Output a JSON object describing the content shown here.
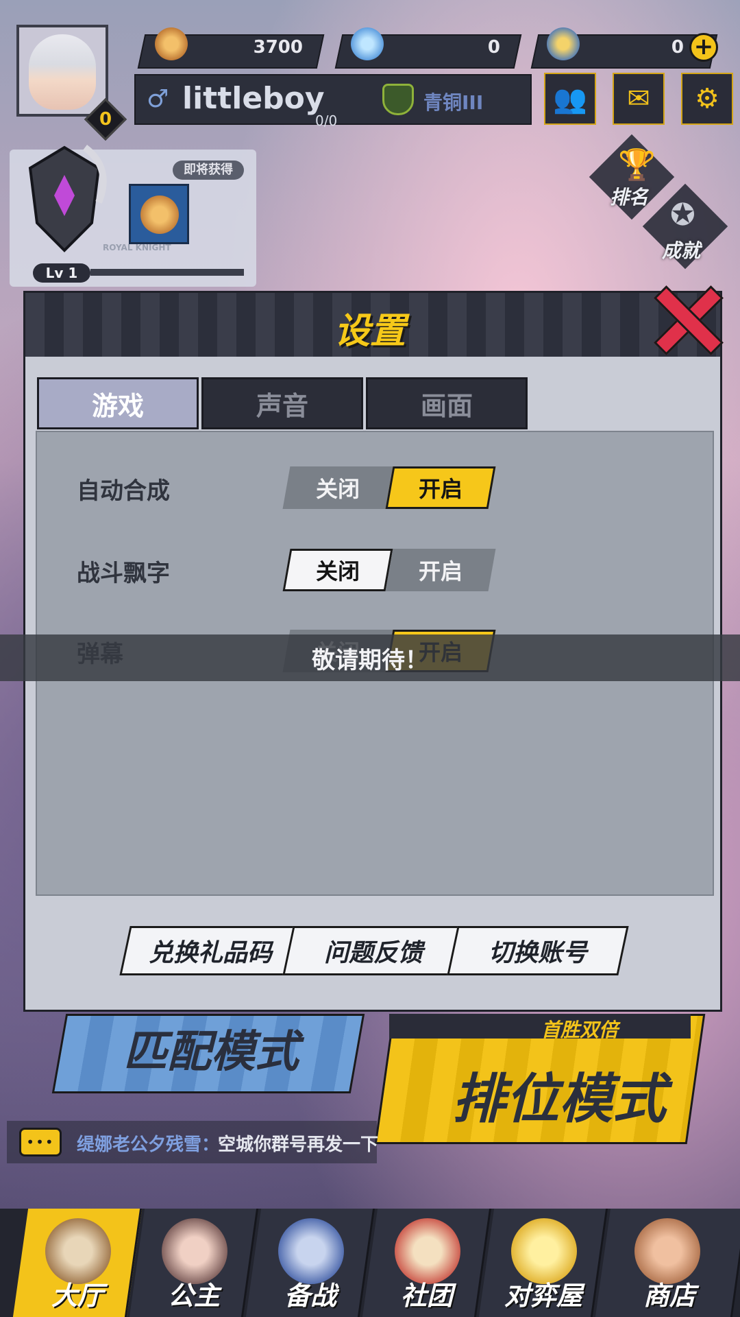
{
  "currencies": [
    {
      "icon": "coin-can-icon",
      "value": "3700"
    },
    {
      "icon": "diamond-icon",
      "value": "0"
    },
    {
      "icon": "ticket-icon",
      "value": "0"
    }
  ],
  "player": {
    "avatar_level": "0",
    "name": "littleboy",
    "rank": "青铜III",
    "exp": "0/0"
  },
  "knight_card": {
    "soon_label": "即将获得",
    "emblem_caption": "ROYAL KNIGHT",
    "level": "Lv 1"
  },
  "side_icons": [
    {
      "label": "排名",
      "icon": "trophy-icon"
    },
    {
      "label": "成就",
      "icon": "medal-icon"
    }
  ],
  "dialog": {
    "title": "设置",
    "tabs": [
      {
        "label": "游戏",
        "active": true
      },
      {
        "label": "声音",
        "active": false
      },
      {
        "label": "画面",
        "active": false
      }
    ],
    "rows": [
      {
        "label": "自动合成",
        "off": "关闭",
        "on": "开启",
        "selected": "on"
      },
      {
        "label": "战斗飘字",
        "off": "关闭",
        "on": "开启",
        "selected": "off"
      },
      {
        "label": "弹幕",
        "off": "关闭",
        "on": "开启",
        "selected": "on"
      }
    ],
    "toast": "敬请期待！",
    "actions": [
      "兑换礼品码",
      "问题反馈",
      "切换账号"
    ]
  },
  "lobby": {
    "match_mode": "匹配模式",
    "rank_mode": "排位模式",
    "first_win": "首胜双倍",
    "chat_sender": "缇娜老公夕残雪：",
    "chat_message": "空城你群号再发一下"
  },
  "nav": [
    {
      "label": "大厅",
      "active": true
    },
    {
      "label": "公主",
      "active": false
    },
    {
      "label": "备战",
      "active": false
    },
    {
      "label": "社团",
      "active": false
    },
    {
      "label": "对弈屋",
      "active": false
    },
    {
      "label": "商店",
      "active": false
    }
  ],
  "colors": {
    "accent_yellow": "#f6c71a",
    "close_red": "#e0314a",
    "dark_panel": "#2c2f3b",
    "rank_blue": "#6f86c0"
  }
}
